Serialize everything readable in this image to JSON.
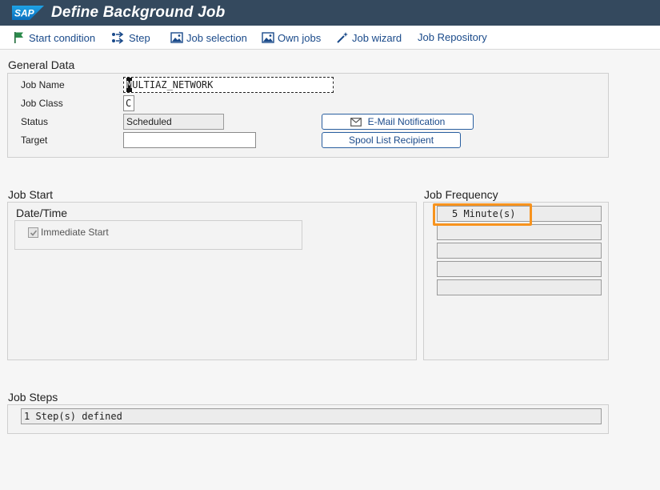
{
  "window": {
    "title": "Define Background Job",
    "logo_text": "SAP"
  },
  "toolbar": {
    "start_condition": "Start condition",
    "step": "Step",
    "job_selection": "Job selection",
    "own_jobs": "Own jobs",
    "job_wizard": "Job wizard",
    "job_repository": "Job Repository"
  },
  "general_data": {
    "title": "General Data",
    "job_name_label": "Job Name",
    "job_name_caret": "M",
    "job_name_rest": "ULTIAZ_NETWORK",
    "job_class_label": "Job Class",
    "job_class_value": "C",
    "status_label": "Status",
    "status_value": "Scheduled",
    "target_label": "Target",
    "target_value": "",
    "email_button": "E-Mail Notification",
    "spool_button": "Spool List Recipient"
  },
  "job_start": {
    "title": "Job Start",
    "datetime_title": "Date/Time",
    "immediate_start_label": "Immediate Start",
    "immediate_start_checked": true
  },
  "job_frequency": {
    "title": "Job Frequency",
    "rows": [
      "5 Minute(s)",
      "",
      "",
      "",
      ""
    ]
  },
  "job_steps": {
    "title": "Job Steps",
    "value": "1 Step(s) defined"
  },
  "colors": {
    "title_bar": "#34495e",
    "link_blue": "#1a4a8a",
    "highlight_orange": "#f7931e"
  }
}
